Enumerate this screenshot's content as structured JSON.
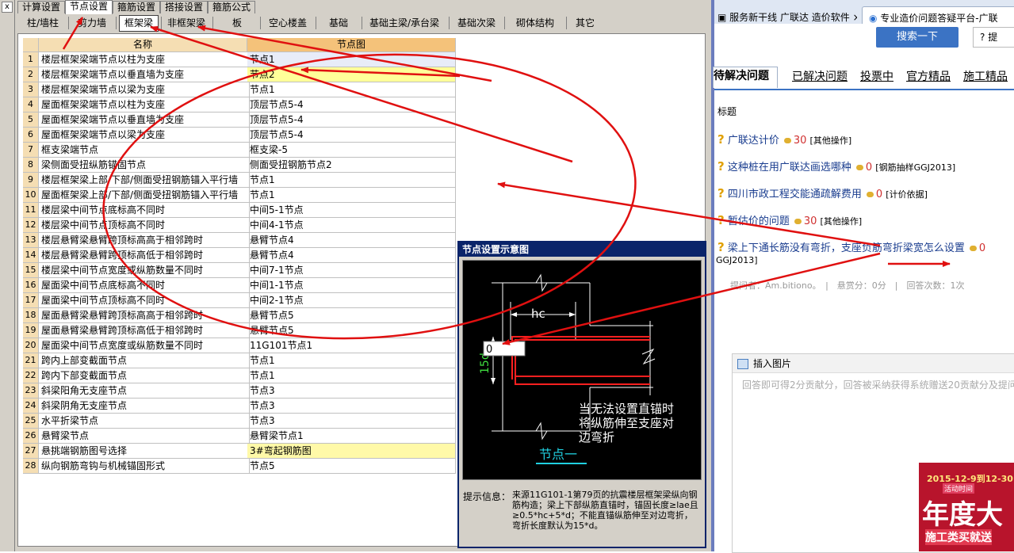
{
  "left_app": {
    "main_tabs": [
      "计算设置",
      "节点设置",
      "箍筋设置",
      "搭接设置",
      "箍筋公式"
    ],
    "active_main_tab": 1,
    "sub_tabs": [
      "柱/墙柱",
      "剪力墙",
      "框架梁",
      "非框架梁",
      "板",
      "空心楼盖",
      "基础",
      "基础主梁/承台梁",
      "基础次梁",
      "砌体结构",
      "其它"
    ],
    "active_sub_tab": 2,
    "table": {
      "headers": [
        "名称",
        "节点图"
      ],
      "rows": [
        {
          "num": "1",
          "name": "楼层框架梁端节点以柱为支座",
          "node": "节点1"
        },
        {
          "num": "2",
          "name": "楼层框架梁端节点以垂直墙为支座",
          "node": "节点2"
        },
        {
          "num": "3",
          "name": "楼层框架梁端节点以梁为支座",
          "node": "节点1"
        },
        {
          "num": "4",
          "name": "屋面框架梁端节点以柱为支座",
          "node": "顶层节点5-4"
        },
        {
          "num": "5",
          "name": "屋面框架梁端节点以垂直墙为支座",
          "node": "顶层节点5-4"
        },
        {
          "num": "6",
          "name": "屋面框架梁端节点以梁为支座",
          "node": "顶层节点5-4"
        },
        {
          "num": "7",
          "name": "框支梁端节点",
          "node": "框支梁-5"
        },
        {
          "num": "8",
          "name": "梁侧面受扭纵筋锚固节点",
          "node": "侧面受扭钢筋节点2"
        },
        {
          "num": "9",
          "name": "楼层框架梁上部/下部/侧面受扭钢筋锚入平行墙",
          "node": "节点1"
        },
        {
          "num": "10",
          "name": "屋面框架梁上部/下部/侧面受扭钢筋锚入平行墙",
          "node": "节点1"
        },
        {
          "num": "11",
          "name": "楼层梁中间节点底标高不同时",
          "node": "中间5-1节点"
        },
        {
          "num": "12",
          "name": "楼层梁中间节点顶标高不同时",
          "node": "中间4-1节点"
        },
        {
          "num": "13",
          "name": "楼层悬臂梁悬臂跨顶标高高于相邻跨时",
          "node": "悬臂节点4"
        },
        {
          "num": "14",
          "name": "楼层悬臂梁悬臂跨顶标高低于相邻跨时",
          "node": "悬臂节点4"
        },
        {
          "num": "15",
          "name": "楼层梁中间节点宽度或纵筋数量不同时",
          "node": "中间7-1节点"
        },
        {
          "num": "16",
          "name": "屋面梁中间节点底标高不同时",
          "node": "中间1-1节点"
        },
        {
          "num": "17",
          "name": "屋面梁中间节点顶标高不同时",
          "node": "中间2-1节点"
        },
        {
          "num": "18",
          "name": "屋面悬臂梁悬臂跨顶标高高于相邻跨时",
          "node": "悬臂节点5"
        },
        {
          "num": "19",
          "name": "屋面悬臂梁悬臂跨顶标高低于相邻跨时",
          "node": "悬臂节点5"
        },
        {
          "num": "20",
          "name": "屋面梁中间节点宽度或纵筋数量不同时",
          "node": "11G101节点1"
        },
        {
          "num": "21",
          "name": "跨内上部变截面节点",
          "node": "节点1"
        },
        {
          "num": "22",
          "name": "跨内下部变截面节点",
          "node": "节点1"
        },
        {
          "num": "23",
          "name": "斜梁阳角无支座节点",
          "node": "节点3"
        },
        {
          "num": "24",
          "name": "斜梁阴角无支座节点",
          "node": "节点3"
        },
        {
          "num": "25",
          "name": "水平折梁节点",
          "node": "节点3"
        },
        {
          "num": "26",
          "name": "悬臂梁节点",
          "node": "悬臂梁节点1"
        },
        {
          "num": "27",
          "name": "悬挑端钢筋图号选择",
          "node": "3#弯起钢筋图"
        },
        {
          "num": "28",
          "name": "纵向钢筋弯钩与机械锚固形式",
          "node": "节点5"
        }
      ]
    },
    "node_panel": {
      "title": "节点设置示意图",
      "hc_label": "hc",
      "input_value": "0",
      "dim_label": "15d",
      "note_lines": [
        "当无法设置直锚时",
        "将纵筋伸至支座对",
        "边弯折"
      ],
      "caption": "节点一",
      "hint_label": "提示信息：",
      "hint_text": "来源11G101-1第79页的抗震楼层框架梁纵向钢筋构造；梁上下部纵筋直锚时，锚固长度≥lae且≥0.5*hc+5*d；不能直锚纵筋伸至对边弯折，弯折长度默认为15*d。"
    },
    "close_glyph": "x"
  },
  "browser": {
    "tabs": [
      "服务新干线 广联达 造价软件",
      "专业造价问题答疑平台-广联"
    ],
    "active_tab": 1,
    "search_button": "搜索一下",
    "help_button": "提",
    "question_tabs": [
      "待解决问题",
      "已解决问题",
      "投票中",
      "官方精品",
      "施工精品"
    ],
    "active_question_tab": 0,
    "list_header": "标题",
    "questions": [
      {
        "title": "广联达计价",
        "score": "30",
        "category": "[其他操作]"
      },
      {
        "title": "这种桩在用广联达画选哪种",
        "score": "0",
        "category": "[钢筋抽样GGJ2013]"
      },
      {
        "title": "四川市政工程交能通疏解费用",
        "score": "0",
        "category": "[计价依据]"
      },
      {
        "title": "暂估价的问题",
        "score": "30",
        "category": "[其他操作]"
      },
      {
        "title": "梁上下通长筋没有弯折，支座负筋弯折梁宽怎么设置",
        "score": "0",
        "category": ""
      }
    ],
    "question_overflow": "GGJ2013]",
    "question_meta": "提问者：Am.bitiono。　|　悬赏分：0分　|　回答次数：1次",
    "insert_image": "插入图片",
    "answer_placeholder": "回答即可得2分贡献分，回答被采纳获得系统赠送20贡献分及提问",
    "ad": {
      "date": "2015-12-9到12-30",
      "badge": "活动时间",
      "big_text": "年度大",
      "small_text": "施工类买就送"
    }
  },
  "colors": {
    "annotation_red": "#e01010",
    "active_title_bar": "#0a246a",
    "diagram_rebar": "#ff2020",
    "diagram_dim": "#40e040",
    "caption_cyan": "#20d0e0"
  }
}
